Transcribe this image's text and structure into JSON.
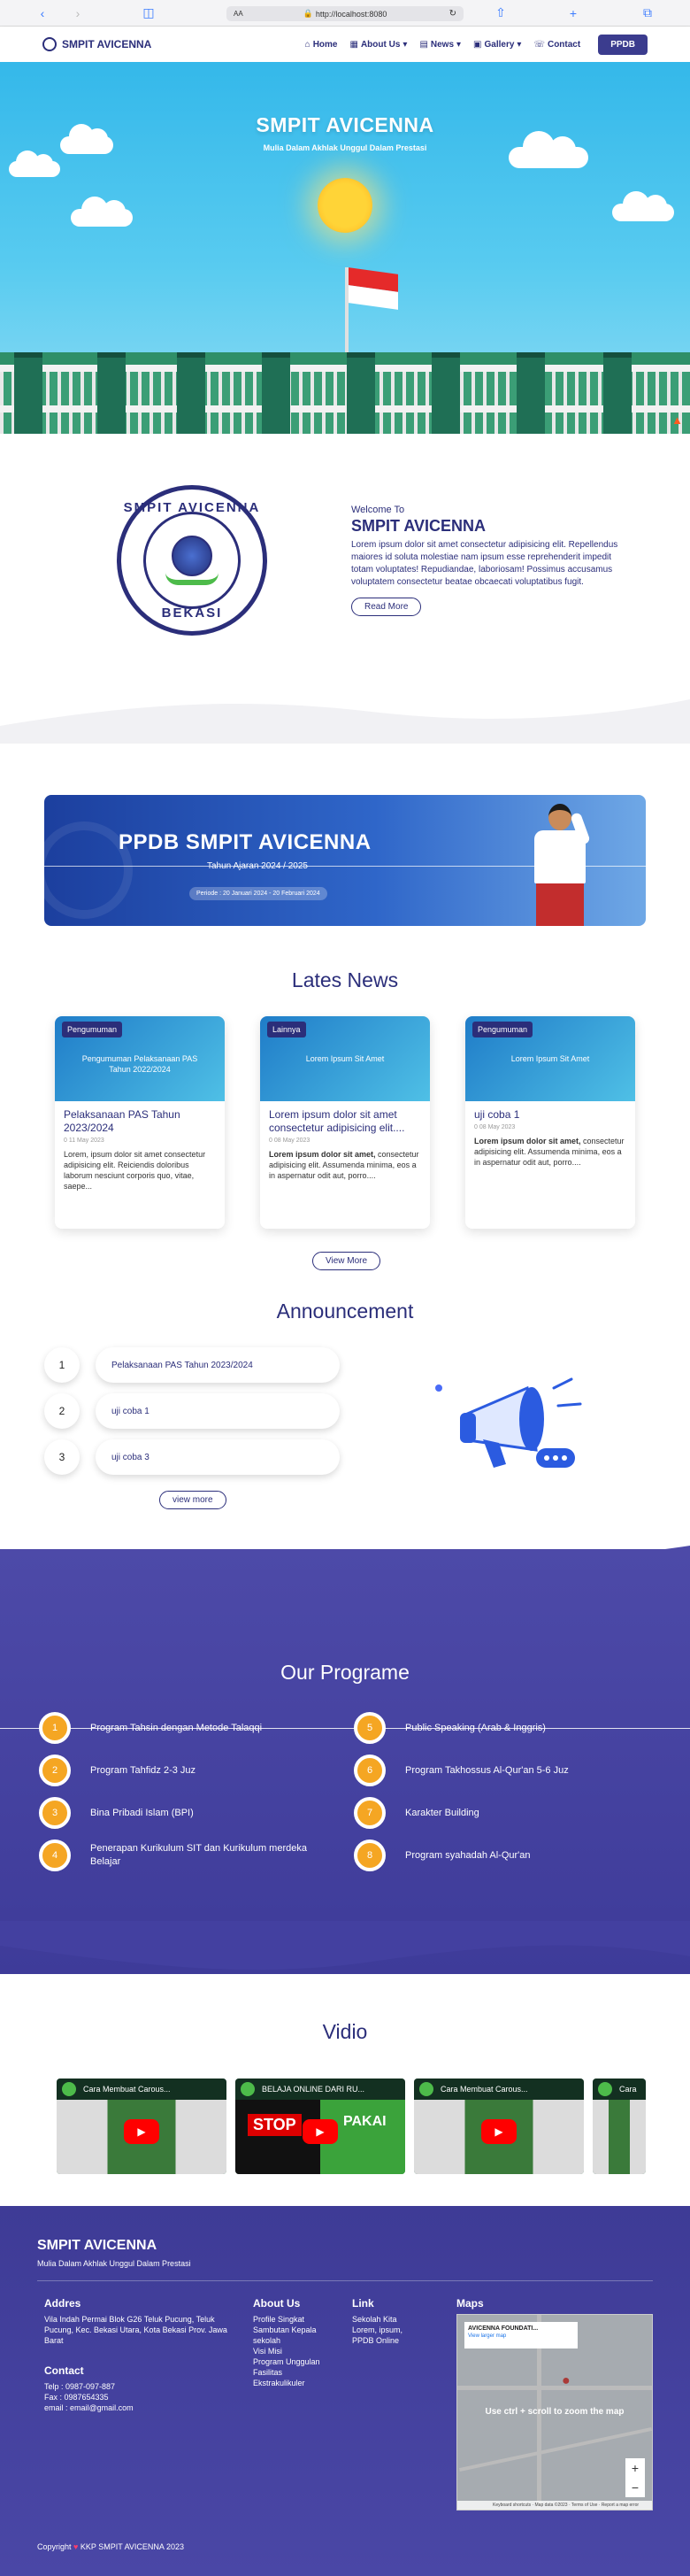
{
  "browser": {
    "back_icon": "chevron-left-icon",
    "forward_icon": "chevron-right-icon",
    "url": "http://localhost:8080",
    "text_size": "AA"
  },
  "navbar": {
    "brand": "SMPIT AVICENNA",
    "links": [
      "Home",
      "About Us",
      "News",
      "Gallery",
      "Contact"
    ],
    "ppdb": "PPDB"
  },
  "hero": {
    "title": "SMPIT AVICENNA",
    "subtitle": "Mulia Dalam Akhlak Unggul Dalam Prestasi"
  },
  "welcome": {
    "logo_text_top": "SMPIT AVICENNA",
    "logo_text_bottom": "BEKASI",
    "small": "Welcome To",
    "title": "SMPIT AVICENNA",
    "paragraph": "Lorem ipsum dolor sit amet consectetur adipisicing elit. Repellendus maiores id soluta molestiae nam ipsum esse reprehenderit impedit totam voluptates! Repudiandae, laboriosam! Possimus accusamus voluptatem consectetur beatae obcaecati voluptatibus fugit.",
    "read_more": "Read More"
  },
  "banner": {
    "title": "PPDB SMPIT AVICENNA",
    "subtitle": "Tahun Ajaran 2024 / 2025",
    "period": "Periode : 20 Januari 2024 - 20 Februari 2024"
  },
  "news": {
    "title": "Lates News",
    "button": "View More",
    "items": [
      {
        "category": "Pengumuman",
        "thumb_text": "Pengumuman Pelaksanaan PAS Tahun 2022/2024",
        "title": "Pelaksanaan PAS Tahun 2023/2024",
        "date": "0 11 May 2023",
        "bold": "",
        "text": "Lorem, ipsum dolor sit amet consectetur adipisicing elit. Reiciendis doloribus laborum nesciunt corporis quo, vitae, saepe..."
      },
      {
        "category": "Lainnya",
        "thumb_text": "Lorem Ipsum Sit Amet",
        "title": "Lorem ipsum dolor sit amet consectetur adipisicing elit....",
        "date": "0 08 May 2023",
        "bold": "Lorem ipsum dolor sit amet,",
        "text": " consectetur adipisicing elit. Assumenda minima, eos a in aspernatur odit aut, porro...."
      },
      {
        "category": "Pengumuman",
        "thumb_text": "Lorem Ipsum Sit Amet",
        "title": "uji coba 1",
        "date": "0 08 May 2023",
        "bold": "Lorem ipsum dolor sit amet,",
        "text": " consectetur adipisicing elit. Assumenda minima, eos a in aspernatur odit aut, porro...."
      }
    ]
  },
  "announcement": {
    "title": "Announcement",
    "items": [
      {
        "num": "1",
        "text": "Pelaksanaan PAS Tahun 2023/2024"
      },
      {
        "num": "2",
        "text": "uji coba 1"
      },
      {
        "num": "3",
        "text": "uji coba 3"
      }
    ],
    "button": "view more"
  },
  "programs": {
    "title": "Our Programe",
    "left": [
      {
        "num": "1",
        "text": "Program Tahsin dengan Metode Talaqqi"
      },
      {
        "num": "2",
        "text": "Program Tahfidz 2-3 Juz"
      },
      {
        "num": "3",
        "text": "Bina Pribadi Islam (BPI)"
      },
      {
        "num": "4",
        "text": "Penerapan Kurikulum SIT dan Kurikulum merdeka Belajar"
      }
    ],
    "right": [
      {
        "num": "5",
        "text": "Public Speaking (Arab & Inggris)"
      },
      {
        "num": "6",
        "text": "Program Takhossus Al-Qur'an 5-6 Juz"
      },
      {
        "num": "7",
        "text": "Karakter Building"
      },
      {
        "num": "8",
        "text": "Program syahadah Al-Qur'an"
      }
    ]
  },
  "videos": {
    "title": "Vidio",
    "items": [
      {
        "title": "Cara Membuat Carous..."
      },
      {
        "title": "BELAJA ONLINE DARI RU..."
      },
      {
        "title": "Cara Membuat Carous..."
      },
      {
        "title": "Cara"
      }
    ],
    "stop_text": "STOP",
    "pakai_text": "PAKAI"
  },
  "footer": {
    "brand": "SMPIT AVICENNA",
    "tagline": "Mulia Dalam Akhlak Unggul Dalam Prestasi",
    "address_title": "Addres",
    "address": "Vila Indah Permai Blok G26 Teluk Pucung, Teluk Pucung, Kec. Bekasi Utara, Kota Bekasi Prov. Jawa Barat",
    "contact_title": "Contact",
    "telp": "Telp : 0987-097-887",
    "fax": "Fax : 0987654335",
    "email": "email : email@gmail.com",
    "about_title": "About Us",
    "about_links": [
      "Profile Singkat",
      "Sambutan Kepala sekolah",
      "Visi Misi",
      "Program Unggulan",
      "Fasilitas",
      "Ekstrakulikuler"
    ],
    "link_title": "Link",
    "link_links": [
      "Sekolah Kita",
      "Lorem, ipsum,",
      "PPDB Online"
    ],
    "maps_title": "Maps",
    "map_card": "AVICENNA FOUNDATI...",
    "map_card_link": "View larger map",
    "map_msg": "Use ctrl + scroll to zoom the map",
    "copyright": "Copyright",
    "copyright_by": "KKP SMPIT AVICENNA 2023"
  },
  "colors": {
    "primary": "#2b2e7a",
    "accent": "#f5a623",
    "program_bg": "#4d4aa8"
  }
}
